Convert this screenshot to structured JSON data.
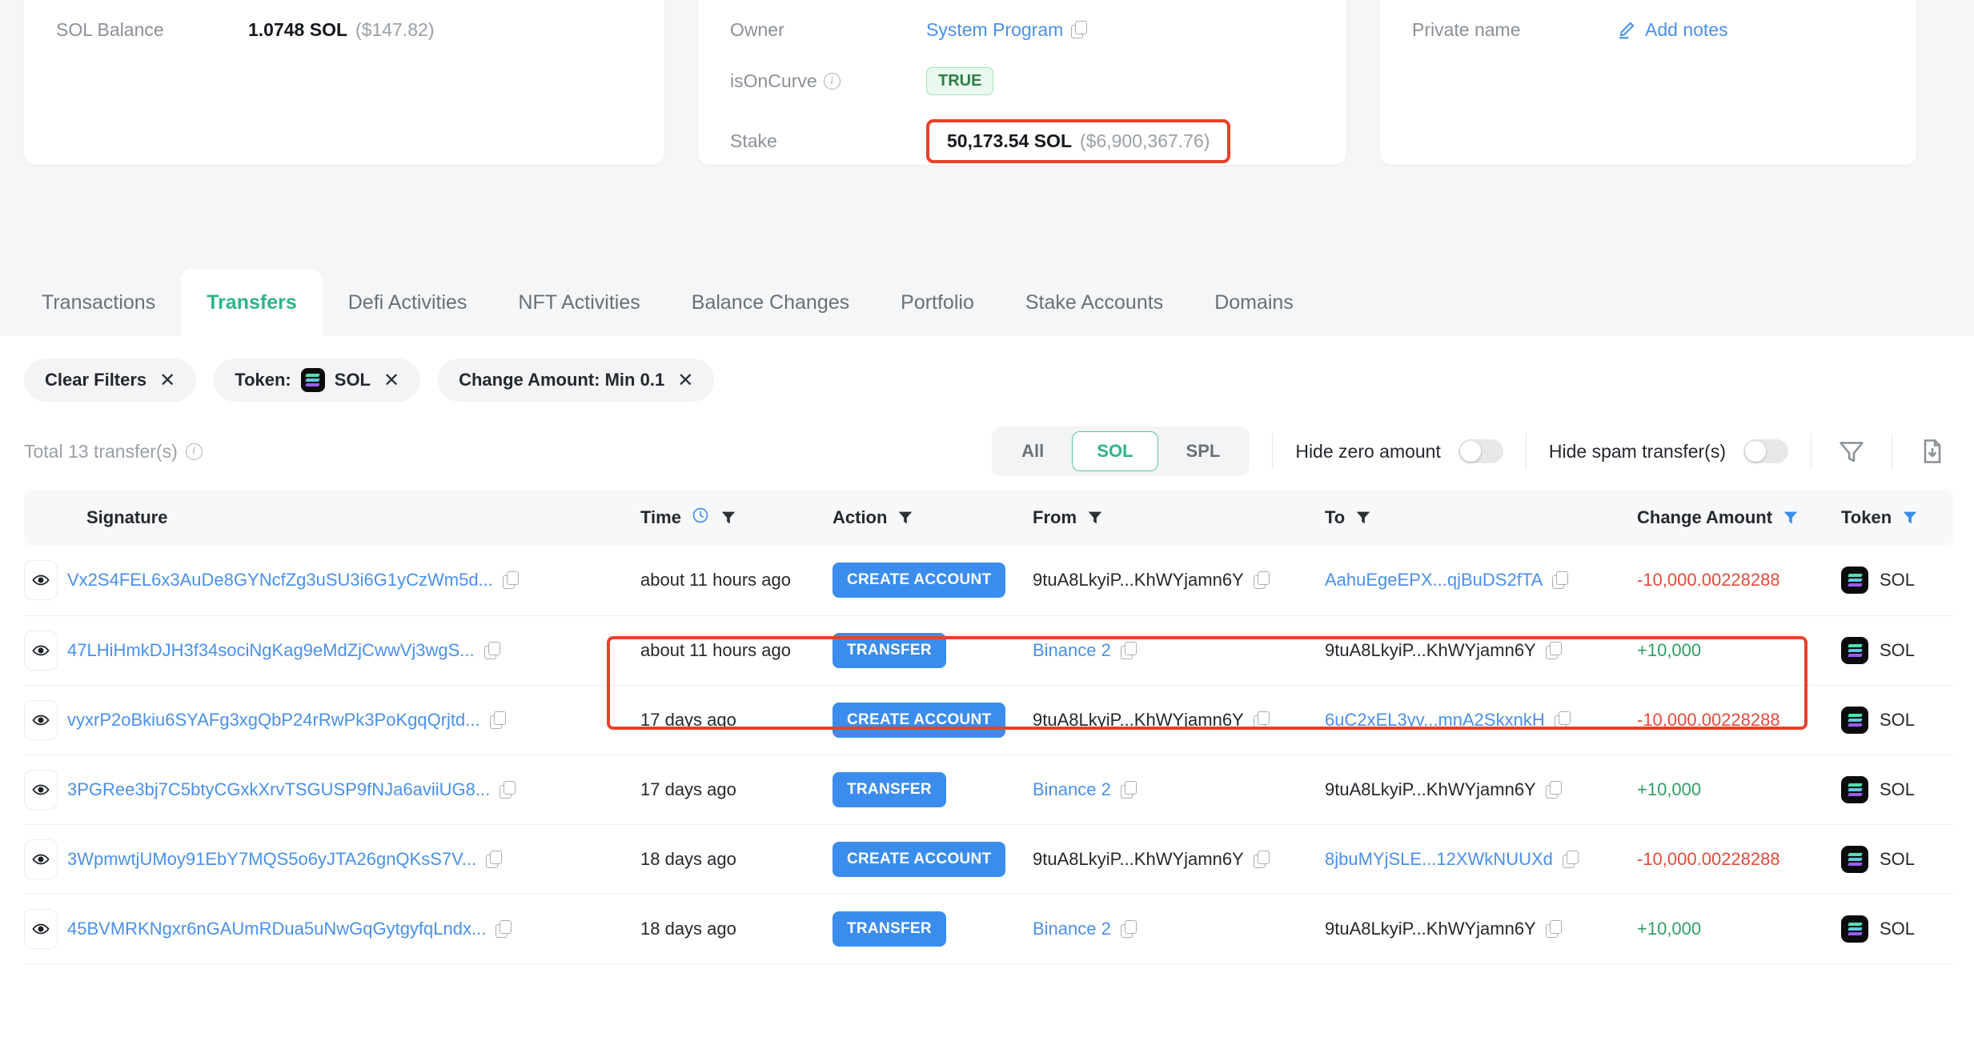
{
  "cards": {
    "left": {
      "label": "SOL Balance",
      "amount": "1.0748 SOL",
      "usd": "($147.82)"
    },
    "middle": {
      "owner_label": "Owner",
      "owner_value": "System Program",
      "oncurve_label": "isOnCurve",
      "oncurve_value": "TRUE",
      "stake_label": "Stake",
      "stake_amount": "50,173.54 SOL",
      "stake_usd": "($6,900,367.76)"
    },
    "right": {
      "private_name_label": "Private name",
      "add_notes": "Add notes"
    }
  },
  "tabs": [
    {
      "label": "Transactions",
      "active": false
    },
    {
      "label": "Transfers",
      "active": true
    },
    {
      "label": "Defi Activities",
      "active": false
    },
    {
      "label": "NFT Activities",
      "active": false
    },
    {
      "label": "Balance Changes",
      "active": false
    },
    {
      "label": "Portfolio",
      "active": false
    },
    {
      "label": "Stake Accounts",
      "active": false
    },
    {
      "label": "Domains",
      "active": false
    }
  ],
  "filters": {
    "clear": "Clear Filters",
    "token_prefix": "Token:",
    "token_value": "SOL",
    "change_amount": "Change Amount: Min 0.1"
  },
  "toolbar": {
    "total": "Total 13 transfer(s)",
    "segments": [
      {
        "label": "All",
        "selected": false
      },
      {
        "label": "SOL",
        "selected": true
      },
      {
        "label": "SPL",
        "selected": false
      }
    ],
    "hide_zero": "Hide zero amount",
    "hide_spam": "Hide spam transfer(s)",
    "hide_zero_on": false,
    "hide_spam_on": false
  },
  "table": {
    "columns": [
      {
        "label": "Signature",
        "filter": false,
        "filter_active": false,
        "clock": false
      },
      {
        "label": "Time",
        "filter": true,
        "filter_active": false,
        "clock": true
      },
      {
        "label": "Action",
        "filter": true,
        "filter_active": false,
        "clock": false
      },
      {
        "label": "From",
        "filter": true,
        "filter_active": false,
        "clock": false
      },
      {
        "label": "To",
        "filter": true,
        "filter_active": false,
        "clock": false
      },
      {
        "label": "Change Amount",
        "filter": true,
        "filter_active": true,
        "clock": false
      },
      {
        "label": "Token",
        "filter": true,
        "filter_active": true,
        "clock": false
      }
    ],
    "rows": [
      {
        "signature": "Vx2S4FEL6x3AuDe8GYNcfZg3uSU3i6G1yCzWm5d...",
        "time": "about 11 hours ago",
        "action": "CREATE ACCOUNT",
        "from": "9tuA8LkyiP...KhWYjamn6Y",
        "from_link": false,
        "to": "AahuEgeEPX...qjBuDS2fTA",
        "to_link": true,
        "amount": "-10,000.00228288",
        "amount_sign": "neg",
        "token": "SOL"
      },
      {
        "signature": "47LHiHmkDJH3f34sociNgKag9eMdZjCwwVj3wgS...",
        "time": "about 11 hours ago",
        "action": "TRANSFER",
        "from": "Binance 2",
        "from_link": true,
        "to": "9tuA8LkyiP...KhWYjamn6Y",
        "to_link": false,
        "amount": "+10,000",
        "amount_sign": "pos",
        "token": "SOL"
      },
      {
        "signature": "vyxrP2oBkiu6SYAFg3xgQbP24rRwPk3PoKgqQrjtd...",
        "time": "17 days ago",
        "action": "CREATE ACCOUNT",
        "from": "9tuA8LkyiP...KhWYjamn6Y",
        "from_link": false,
        "to": "6uC2xEL3yv...mnA2SkxnkH",
        "to_link": true,
        "amount": "-10,000.00228288",
        "amount_sign": "neg",
        "token": "SOL"
      },
      {
        "signature": "3PGRee3bj7C5btyCGxkXrvTSGUSP9fNJa6aviiUG8...",
        "time": "17 days ago",
        "action": "TRANSFER",
        "from": "Binance 2",
        "from_link": true,
        "to": "9tuA8LkyiP...KhWYjamn6Y",
        "to_link": false,
        "amount": "+10,000",
        "amount_sign": "pos",
        "token": "SOL"
      },
      {
        "signature": "3WpmwtjUMoy91EbY7MQS5o6yJTA26gnQKsS7V...",
        "time": "18 days ago",
        "action": "CREATE ACCOUNT",
        "from": "9tuA8LkyiP...KhWYjamn6Y",
        "from_link": false,
        "to": "8jbuMYjSLE...12XWkNUUXd",
        "to_link": true,
        "amount": "-10,000.00228288",
        "amount_sign": "neg",
        "token": "SOL"
      },
      {
        "signature": "45BVMRKNgxr6nGAUmRDua5uNwGqGytgyfqLndx...",
        "time": "18 days ago",
        "action": "TRANSFER",
        "from": "Binance 2",
        "from_link": true,
        "to": "9tuA8LkyiP...KhWYjamn6Y",
        "to_link": false,
        "amount": "+10,000",
        "amount_sign": "pos",
        "token": "SOL"
      }
    ]
  },
  "colors": {
    "accent_green": "#2db588",
    "link_blue": "#4a90e8",
    "action_blue": "#3b8ded",
    "negative": "#e14b3a",
    "positive": "#2f9e63",
    "highlight_red": "#e8412a"
  }
}
